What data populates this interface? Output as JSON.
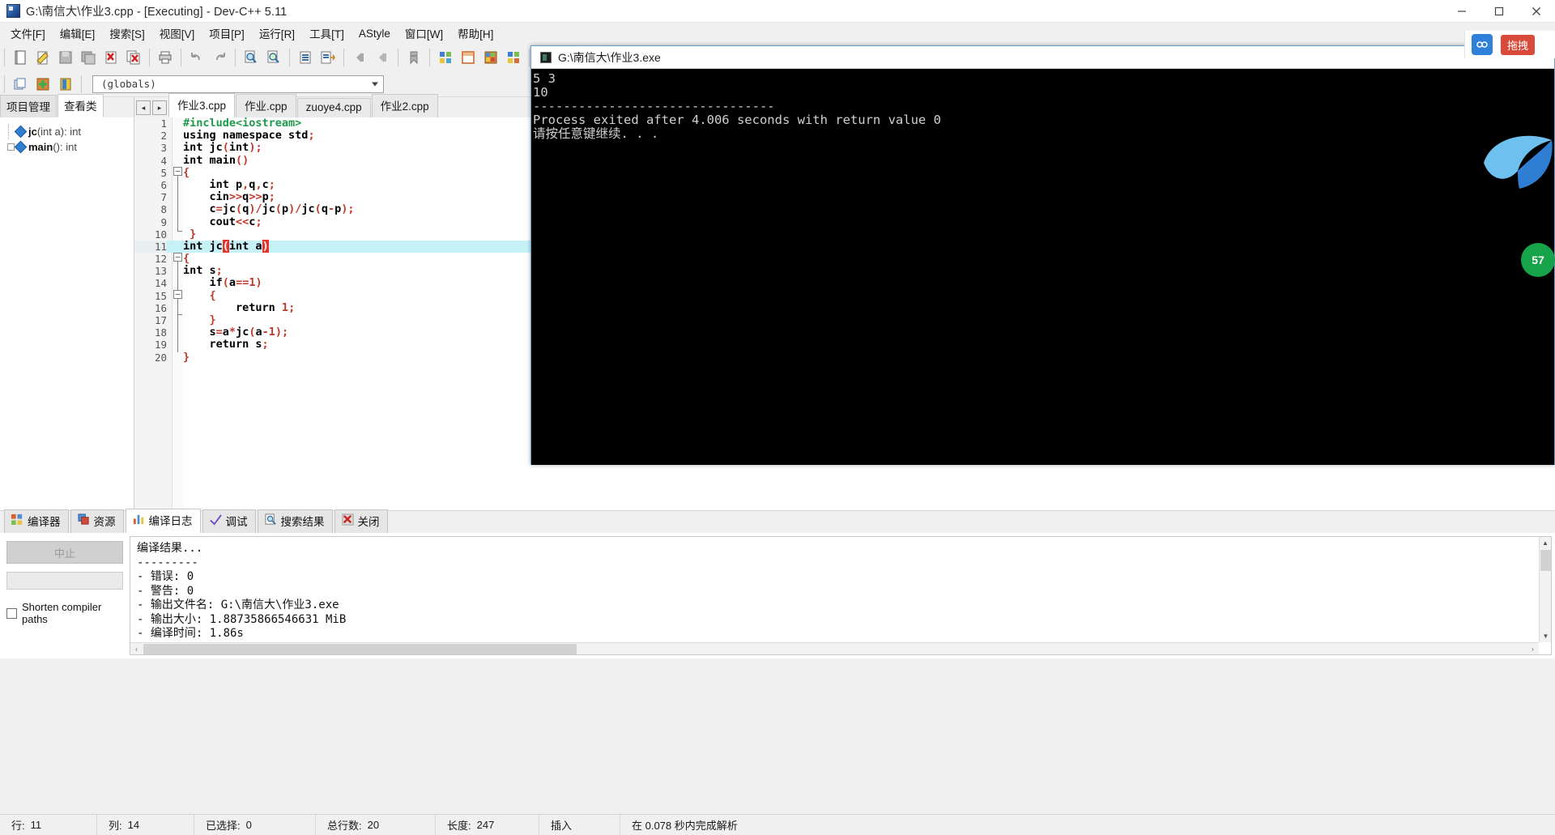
{
  "window": {
    "title": "G:\\南信大\\作业3.cpp - [Executing] - Dev-C++ 5.11",
    "minimize": "–",
    "maximize": "▢",
    "close": "✕"
  },
  "menubar": {
    "items": [
      {
        "label": "文件[F]"
      },
      {
        "label": "编辑[E]"
      },
      {
        "label": "搜索[S]"
      },
      {
        "label": "视图[V]"
      },
      {
        "label": "项目[P]"
      },
      {
        "label": "运行[R]"
      },
      {
        "label": "工具[T]"
      },
      {
        "label": "AStyle"
      },
      {
        "label": "窗口[W]"
      },
      {
        "label": "帮助[H]"
      }
    ]
  },
  "toolbar": {
    "row1_icons": [
      "new-file-icon",
      "open-file-icon",
      "save-icon",
      "save-all-icon",
      "close-file-icon",
      "close-all-icon",
      "print-icon",
      "undo-icon",
      "redo-icon",
      "find-icon",
      "find-next-icon",
      "goto-line-icon",
      "replace-icon",
      "back-icon",
      "forward-icon",
      "toggle-bookmark-icon",
      "project-options-icon",
      "compiler-options-icon",
      "environment-options-icon",
      "window-list-icon",
      "compile-icon",
      "stop-icon",
      "profile-icon",
      "debug-icon"
    ],
    "row2_icons": [
      "new-project-icon",
      "add-to-project-icon",
      "remove-from-project-icon"
    ],
    "scope_combo": {
      "value": "(globals)",
      "arrow": "▾"
    }
  },
  "left_panel": {
    "tabs": [
      {
        "label": "项目管理",
        "active": false
      },
      {
        "label": "查看类",
        "active": true
      }
    ],
    "tree": [
      {
        "name": "jc",
        "signature": "(int a)",
        "type": ": int",
        "bold": true
      },
      {
        "name": "main",
        "signature": "()",
        "type": ": int",
        "bold": true
      }
    ]
  },
  "editor": {
    "nav_prev": "◂",
    "nav_next": "▸",
    "tabs": [
      {
        "label": "作业3.cpp",
        "active": true
      },
      {
        "label": "作业.cpp",
        "active": false
      },
      {
        "label": "zuoye4.cpp",
        "active": false
      },
      {
        "label": "作业2.cpp",
        "active": false
      }
    ],
    "lines": [
      {
        "n": 1,
        "text": "#include<iostream>"
      },
      {
        "n": 2,
        "text": "using namespace std;"
      },
      {
        "n": 3,
        "text": "int jc(int);"
      },
      {
        "n": 4,
        "text": "int main()"
      },
      {
        "n": 5,
        "text": "{"
      },
      {
        "n": 6,
        "text": "    int p,q,c;"
      },
      {
        "n": 7,
        "text": "    cin>>q>>p;"
      },
      {
        "n": 8,
        "text": "    c=jc(q)/jc(p)/jc(q-p);"
      },
      {
        "n": 9,
        "text": "    cout<<c;"
      },
      {
        "n": 10,
        "text": " }"
      },
      {
        "n": 11,
        "text": "int jc(int a)"
      },
      {
        "n": 12,
        "text": "{"
      },
      {
        "n": 13,
        "text": "int s;"
      },
      {
        "n": 14,
        "text": "    if(a==1)"
      },
      {
        "n": 15,
        "text": "    {"
      },
      {
        "n": 16,
        "text": "        return 1;"
      },
      {
        "n": 17,
        "text": "    }"
      },
      {
        "n": 18,
        "text": "    s=a*jc(a-1);"
      },
      {
        "n": 19,
        "text": "    return s;"
      },
      {
        "n": 20,
        "text": "}"
      }
    ],
    "highlighted_line": 11
  },
  "console": {
    "title": "G:\\南信大\\作业3.exe",
    "output": "5 3\n10\n--------------------------------\nProcess exited after 4.006 seconds with return value 0\n请按任意键继续. . ."
  },
  "floating": {
    "capture_label": "拖拽",
    "badge_count": "57"
  },
  "bottom_panel": {
    "tabs": [
      {
        "label": "编译器",
        "icon": "compiler-icon",
        "active": false
      },
      {
        "label": "资源",
        "icon": "resource-icon",
        "active": false
      },
      {
        "label": "编译日志",
        "icon": "compile-log-icon",
        "active": true
      },
      {
        "label": "调试",
        "icon": "debug-check-icon",
        "active": false
      },
      {
        "label": "搜索结果",
        "icon": "search-result-icon",
        "active": false
      },
      {
        "label": "关闭",
        "icon": "close-red-icon",
        "active": false
      }
    ],
    "abort_button": "中止",
    "shorten_checkbox_label": "Shorten compiler paths",
    "log": "编译结果...\n---------\n- 错误: 0\n- 警告: 0\n- 输出文件名: G:\\南信大\\作业3.exe\n- 输出大小: 1.88735866546631 MiB\n- 编译时间: 1.86s",
    "scroll_left": "‹",
    "scroll_right": "›",
    "scroll_up": "▲",
    "scroll_down": "▼"
  },
  "statusbar": {
    "cells": [
      {
        "label": "行:",
        "value": "11"
      },
      {
        "label": "列:",
        "value": "14"
      },
      {
        "label": "已选择:",
        "value": "0"
      },
      {
        "label": "总行数:",
        "value": "20"
      },
      {
        "label": "长度:",
        "value": "247"
      },
      {
        "label": "插入",
        "value": ""
      },
      {
        "label": "在 0.078 秒内完成解析",
        "value": ""
      }
    ]
  },
  "colors": {
    "accent": "#2f80d8",
    "highlight_line": "#c6f2f7",
    "bracket_match": "#e8342a",
    "preprocessor": "#1e9a4a",
    "punctuation": "#c0392b",
    "console_bg": "#000000",
    "console_fg": "#cfcfcf"
  }
}
